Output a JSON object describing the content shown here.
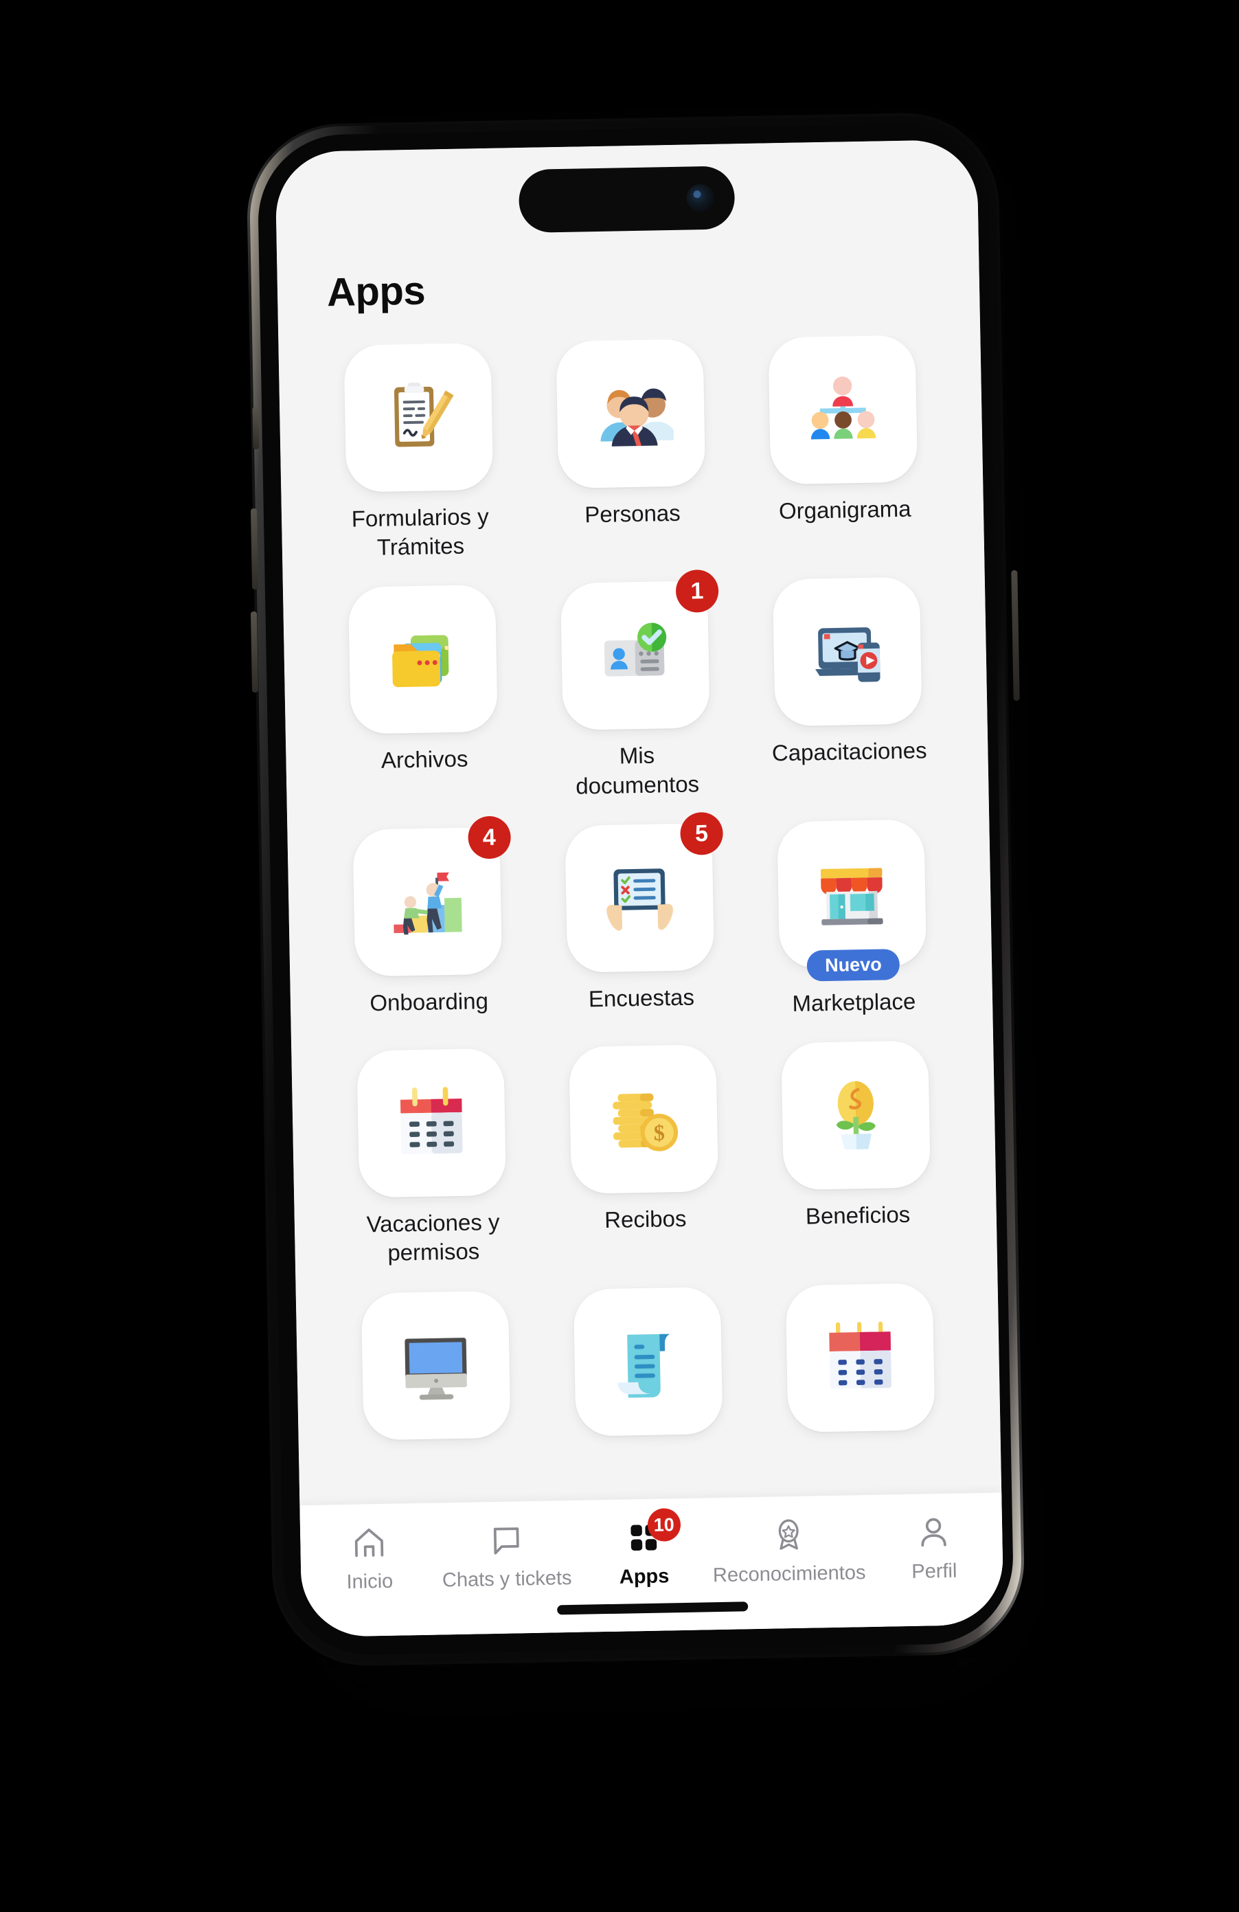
{
  "device": {
    "type": "smartphone-mockup",
    "notch": "dynamic-island",
    "home_indicator": true
  },
  "header": {
    "title": "Apps"
  },
  "apps": [
    {
      "label": "Formularios y Trámites",
      "icon": "clipboard-pencil-icon",
      "badge": null,
      "tag": null
    },
    {
      "label": "Personas",
      "icon": "people-group-icon",
      "badge": null,
      "tag": null
    },
    {
      "label": "Organigrama",
      "icon": "org-chart-icon",
      "badge": null,
      "tag": null
    },
    {
      "label": "Archivos",
      "icon": "folder-files-icon",
      "badge": null,
      "tag": null
    },
    {
      "label": "Mis documentos",
      "icon": "id-card-check-icon",
      "badge": "1",
      "tag": null
    },
    {
      "label": "Capacitaciones",
      "icon": "elearning-icon",
      "badge": null,
      "tag": null
    },
    {
      "label": "Onboarding",
      "icon": "climbing-steps-icon",
      "badge": "4",
      "tag": null
    },
    {
      "label": "Encuestas",
      "icon": "survey-tablet-icon",
      "badge": "5",
      "tag": null
    },
    {
      "label": "Marketplace",
      "icon": "storefront-icon",
      "badge": null,
      "tag": "Nuevo"
    },
    {
      "label": "Vacaciones y permisos",
      "icon": "calendar-red-icon",
      "badge": null,
      "tag": null
    },
    {
      "label": "Recibos",
      "icon": "coins-stack-icon",
      "badge": null,
      "tag": null
    },
    {
      "label": "Beneficios",
      "icon": "money-plant-icon",
      "badge": null,
      "tag": null
    },
    {
      "label": "",
      "icon": "desktop-monitor-icon",
      "badge": null,
      "tag": null
    },
    {
      "label": "",
      "icon": "scroll-document-icon",
      "badge": null,
      "tag": null
    },
    {
      "label": "",
      "icon": "calendar-pink-icon",
      "badge": null,
      "tag": null
    }
  ],
  "tabbar": [
    {
      "label": "Inicio",
      "icon": "home-icon",
      "active": false,
      "badge": null
    },
    {
      "label": "Chats y tickets",
      "icon": "chat-bubble-icon",
      "active": false,
      "badge": null
    },
    {
      "label": "Apps",
      "icon": "grid-apps-icon",
      "active": true,
      "badge": "10"
    },
    {
      "label": "Reconocimientos",
      "icon": "award-badge-icon",
      "active": false,
      "badge": null
    },
    {
      "label": "Perfil",
      "icon": "person-icon",
      "active": false,
      "badge": null
    }
  ],
  "colors": {
    "screen_background": "#f4f4f4",
    "tile_background": "#ffffff",
    "badge_red": "#cd2018",
    "tag_blue": "#3f72d7",
    "text_primary": "#18181b",
    "text_muted": "#8c8c92"
  }
}
